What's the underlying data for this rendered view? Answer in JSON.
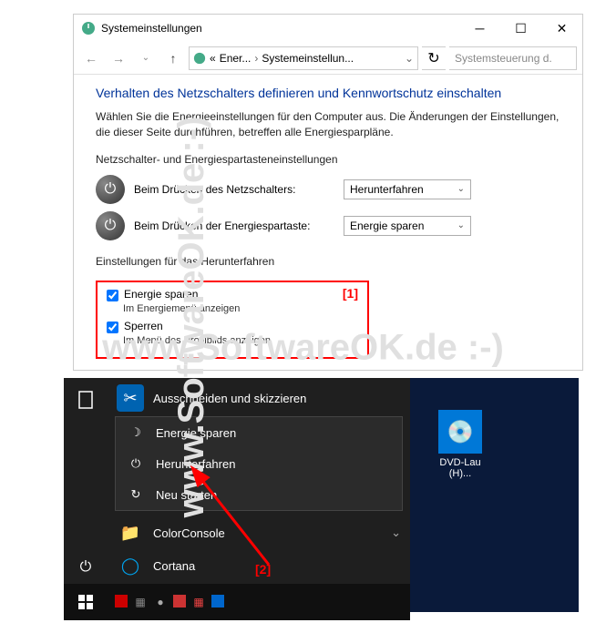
{
  "watermark": "www.SoftwareOK.de :-)",
  "window": {
    "title": "Systemeinstellungen",
    "breadcrumb": {
      "part1": "Ener...",
      "part2": "Systemeinstellun..."
    },
    "search_placeholder": "Systemsteuerung d.",
    "heading": "Verhalten des Netzschalters definieren und Kennwortschutz einschalten",
    "description": "Wählen Sie die Energieeinstellungen für den Computer aus. Die Änderungen der Einstellungen, die dieser Seite durchführen, betreffen alle Energiesparpläne.",
    "section1_label": "Netzschalter- und Energiespartasteneinstellungen",
    "row1": {
      "label": "Beim Drücken des Netzschalters:",
      "value": "Herunterfahren"
    },
    "row2": {
      "label": "Beim Drücken der Energiespartaste:",
      "value": "Energie sparen"
    },
    "section2_label": "Einstellungen für das Herunterfahren",
    "annotation1": "[1]",
    "check1": {
      "label": "Energie sparen",
      "sub": "Im Energiemenü anzeigen"
    },
    "check2": {
      "label": "Sperren",
      "sub": "Im Menü des Profilbilds anzeigen"
    }
  },
  "startmenu": {
    "top_app": "Ausschneiden und skizzieren",
    "power_items": [
      "Energie sparen",
      "Herunterfahren",
      "Neu starten"
    ],
    "apps": [
      "ColorConsole",
      "Cortana"
    ]
  },
  "annotation2": "[2]",
  "tile": {
    "label": "DVD-Lau (H)..."
  }
}
